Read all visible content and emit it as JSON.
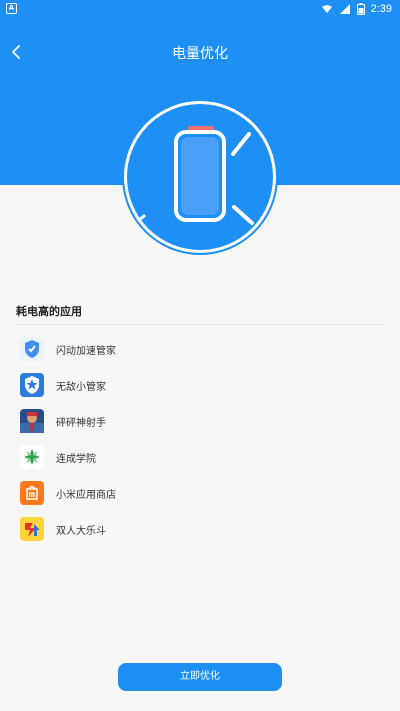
{
  "status_bar": {
    "left_icon_glyph": "A",
    "time": "2:39",
    "icons": [
      "wifi-icon",
      "signal-icon",
      "battery-icon"
    ]
  },
  "header": {
    "title": "电量优化",
    "background_color": "#1E8FF5"
  },
  "main": {
    "battery_icon": "battery-icon",
    "section_title": "耗电高的应用",
    "apps": [
      {
        "label": "闪动加速管家",
        "icon": "shield-icon"
      },
      {
        "label": "无敌小管家",
        "icon": "shield-star-icon"
      },
      {
        "label": "砰砰神射手",
        "icon": "game-icon"
      },
      {
        "label": "连成学院",
        "icon": "palm-icon"
      },
      {
        "label": "小米应用商店",
        "icon": "mi-store-icon"
      },
      {
        "label": "双人大乐斗",
        "icon": "duo-icon"
      }
    ]
  },
  "footer": {
    "button_label": "立即优化"
  }
}
